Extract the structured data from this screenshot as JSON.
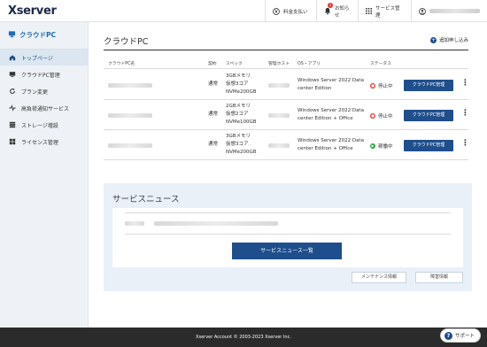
{
  "header": {
    "logo": "Xserver",
    "pay_label": "料金支払い",
    "news_label": "お知らせ",
    "news_badge": "1",
    "services_label": "サービス管理"
  },
  "sidebar": {
    "title": "クラウドPC",
    "items": [
      {
        "label": "トップページ",
        "icon": "home-icon"
      },
      {
        "label": "クラウドPC管理",
        "icon": "monitor-icon"
      },
      {
        "label": "プラン変更",
        "icon": "refresh-icon"
      },
      {
        "label": "高負荷通知サービス",
        "icon": "pulse-icon"
      },
      {
        "label": "ストレージ増設",
        "icon": "stack-icon"
      },
      {
        "label": "ライセンス管理",
        "icon": "windows-icon"
      }
    ]
  },
  "main": {
    "title": "クラウドPC",
    "add_label": "追加申し込み",
    "columns": [
      "クラウドPC名",
      "契約",
      "スペック",
      "管理ホスト",
      "OS・アプリ",
      "ステータス"
    ],
    "rows": [
      {
        "contract": "通常",
        "spec1": "3GBメモリ",
        "spec2": "仮想3コア",
        "spec3": "NVMe200GB",
        "os1": "Windows Server 2022 Data",
        "os2": "center Edition",
        "status": "停止中",
        "status_type": "stop",
        "button": "クラウドPC管理"
      },
      {
        "contract": "通常",
        "spec1": "2GBメモリ",
        "spec2": "仮想2コア",
        "spec3": "NVMe100GB",
        "os1": "Windows Server 2022 Data",
        "os2": "center Edition + Office",
        "status": "停止中",
        "status_type": "stop",
        "button": "クラウドPC管理"
      },
      {
        "contract": "通常",
        "spec1": "3GBメモリ",
        "spec2": "仮想3コア",
        "spec3": "NVMe200GB",
        "os1": "Windows Server 2022 Data",
        "os2": "center Edition + Office",
        "status": "稼働中",
        "status_type": "run",
        "button": "クラウドPC管理"
      }
    ]
  },
  "news": {
    "title": "サービスニュース",
    "list_button": "サービスニュース一覧",
    "maintenance_button": "メンテナンス情報",
    "trouble_button": "障害情報"
  },
  "footer": {
    "copyright": "Xserver Account © 2003-2023 Xserver Inc.",
    "support_label": "サポート"
  }
}
